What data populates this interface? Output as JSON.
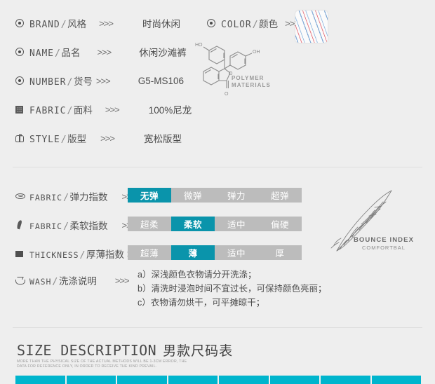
{
  "theme": {
    "background": "#eeeeee",
    "accent_teal": "#0a94ab",
    "accent_cyan": "#00b5cd",
    "bar_gray": "#bcbcbc",
    "text": "#4a4a4a"
  },
  "arrows": ">>>",
  "spec_section": {
    "rows": [
      {
        "icon": "circle-dot-icon",
        "en": "BRAND",
        "cn": "风格",
        "value": "时尚休闲"
      },
      {
        "icon": "circle-dot-icon",
        "en": "NAME",
        "cn": "品名",
        "value": "休闲沙滩裤"
      },
      {
        "icon": "circle-dot-icon",
        "en": "NUMBER",
        "cn": "货号",
        "value": "G5-MS106"
      },
      {
        "icon": "fabric-grid-icon",
        "en": "FABRIC",
        "cn": "面料",
        "value": "100%尼龙"
      },
      {
        "icon": "hanger-icon",
        "en": "STYLE",
        "cn": "版型",
        "value": "宽松版型"
      }
    ],
    "color_row": {
      "icon": "circle-dot-icon",
      "en": "COLOR",
      "cn": "颜色",
      "swatch_name": "striped-fabric-swatch"
    },
    "chem_graphic": {
      "caption_line1": "POLYMER",
      "caption_line2": "MATERIALS",
      "labels": [
        "HO",
        "OH",
        "O",
        "O"
      ]
    }
  },
  "index_section": {
    "rows": [
      {
        "icon": "ring-icon",
        "en": "FABRIC",
        "cn": "弹力指数",
        "segments": [
          "无弹",
          "微弹",
          "弹力",
          "超弹"
        ],
        "selected_index": 0
      },
      {
        "icon": "brush-icon",
        "en": "FABRIC",
        "cn": "柔软指数",
        "segments": [
          "超柔",
          "柔软",
          "适中",
          "偏硬"
        ],
        "selected_index": 1
      },
      {
        "icon": "square-icon",
        "en": "THICKNESS",
        "cn": "厚薄指数",
        "segments": [
          "超薄",
          "薄",
          "适中",
          "厚"
        ],
        "selected_index": 1
      }
    ],
    "wash_row": {
      "icon": "wash-basin-icon",
      "en": "WASH",
      "cn": "洗涤说明",
      "lines": [
        "a）深浅颜色衣物请分开洗涤；",
        "b）清洗时浸泡时间不宜过长，可保持颜色亮丽；",
        "c）衣物请勿烘干，可平摊晾干；"
      ]
    },
    "bounce_graphic": {
      "caption_line1": "BOUNCE INDEX",
      "caption_line2": "COMFORTBAL"
    }
  },
  "size_section": {
    "title_en": "SIZE DESCRIPTION",
    "title_cn": "男款尺码表",
    "subtitle": "MORE THAN THE PHYSICAL SIZE OF THE ACTUAL METHODS WILL BE 1-3CM ERROR, THE DATA FOR REFERENCE ONLY, IN ORDER TO RECEIVE THE KIND PREVAIL.",
    "table_header_columns": 8
  }
}
